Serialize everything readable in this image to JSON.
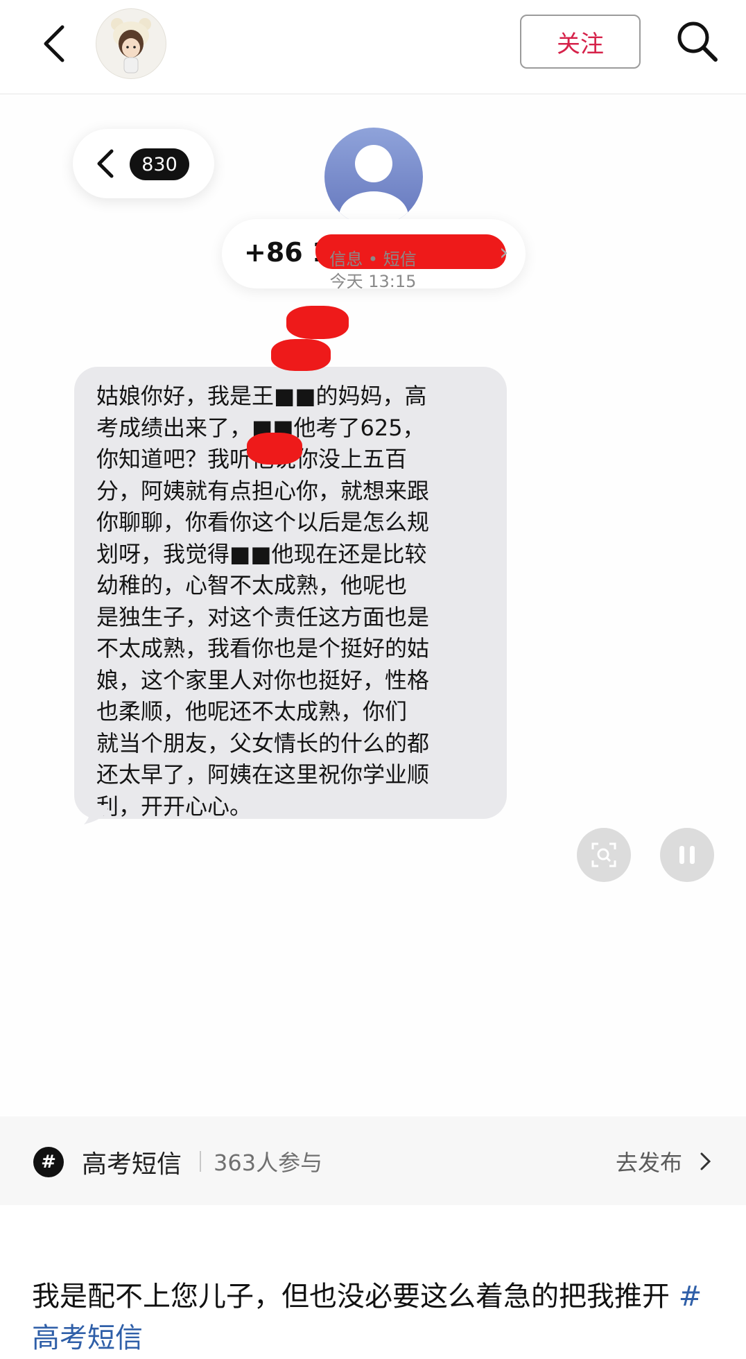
{
  "header": {
    "follow_label": "关注",
    "icons": [
      "back-icon",
      "avatar",
      "search-icon"
    ]
  },
  "message_screen": {
    "unread_count": "830",
    "contact_number": "+86 1",
    "channel": "信息 • 短信",
    "time": "今天 13:15",
    "message_lines": "姑娘你好，我是王■■的妈妈，高\n考成绩出来了，■■他考了625，\n你知道吧？我听他说你没上五百\n分，阿姨就有点担心你，就想来跟\n你聊聊，你看你这个以后是怎么规\n划呀，我觉得■■他现在还是比较\n幼稚的，心智不太成熟，他呢也\n是独生子，对这个责任这方面也是\n不太成熟，我看你也是个挺好的姑\n娘，这个家里人对你也挺好，性格\n也柔顺，他呢还不太成熟，你们\n就当个朋友，父女情长的什么的都\n还太早了，阿姨在这里祝你学业顺\n利，开开心心。",
    "redaction_color": "#ee1a1a"
  },
  "topic_bar": {
    "hash_symbol": "#",
    "topic_name": "高考短信",
    "participants": "363人参与",
    "publish_label": "去发布"
  },
  "post": {
    "caption": "我是配不上您儿子，但也没必要这么着急的把我推开",
    "hashtag": "#高考短信"
  },
  "colors": {
    "follow_text": "#d6224a",
    "hashtag": "#2f5fa8",
    "bubble": "#e9e9ec"
  }
}
